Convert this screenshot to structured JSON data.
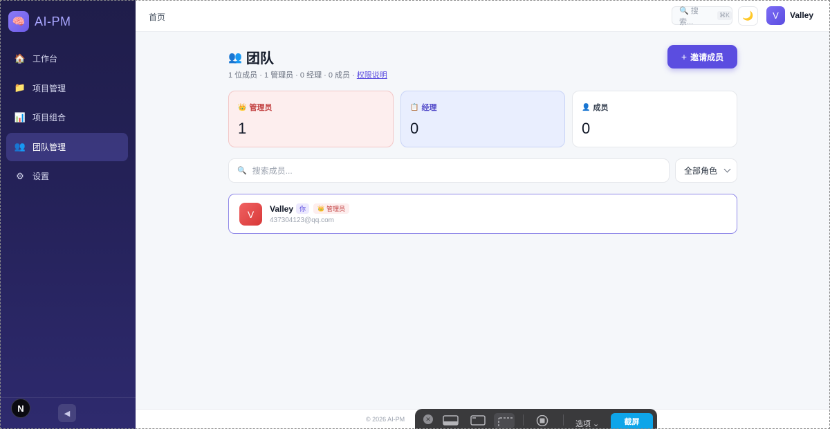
{
  "app": {
    "name": "AI-PM",
    "logo_icon": "brain-icon"
  },
  "sidebar": {
    "items": [
      {
        "label": "工作台",
        "icon": "house-icon",
        "glyph": "🏠",
        "active": false
      },
      {
        "label": "项目管理",
        "icon": "folder-icon",
        "glyph": "📁",
        "active": false
      },
      {
        "label": "项目组合",
        "icon": "bar-chart-icon",
        "glyph": "📊",
        "active": false
      },
      {
        "label": "团队管理",
        "icon": "people-icon",
        "glyph": "👥",
        "active": true
      },
      {
        "label": "设置",
        "icon": "gear-icon",
        "glyph": "⚙",
        "active": false
      }
    ],
    "badge": "N",
    "collapse_glyph": "◀"
  },
  "topbar": {
    "breadcrumb": "首页",
    "search_label": "🔍 搜索...",
    "search_shortcut": "⌘K",
    "theme_glyph": "🌙",
    "user_initial": "V",
    "user_name": "Valley"
  },
  "page": {
    "title_icon": "👥",
    "title": "团队",
    "summary": "1 位成员 · 1 管理员 · 0 经理 · 0 成员 · ",
    "permissions_link": "权限说明",
    "invite_plus": "+",
    "invite_label": "邀请成员"
  },
  "stats": {
    "admin": {
      "icon": "👑",
      "label": "管理员",
      "value": "1"
    },
    "manager": {
      "icon": "📋",
      "label": "经理",
      "value": "0"
    },
    "member": {
      "icon": "👤",
      "label": "成员",
      "value": "0"
    }
  },
  "filters": {
    "search_icon": "🔍",
    "search_placeholder": "搜索成员...",
    "role_selected": "全部角色"
  },
  "members": [
    {
      "initial": "V",
      "name": "Valley",
      "you_badge": "你",
      "role_icon": "👑",
      "role": "管理员",
      "email": "437304123@qq.com"
    }
  ],
  "footer": {
    "copyright": "© 2026 AI-PM"
  },
  "capture_toolbar": {
    "close_glyph": "✕",
    "options_label": "选项 ⌄",
    "shot_label": "截屏"
  },
  "colors": {
    "accent": "#5b4de0",
    "admin": "#c24141",
    "manager": "#4f46c8",
    "sidebar": "#25225a"
  }
}
